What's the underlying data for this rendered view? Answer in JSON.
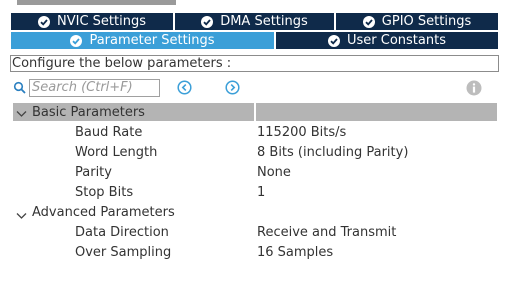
{
  "tabs": {
    "row1": [
      {
        "label": "NVIC Settings"
      },
      {
        "label": "DMA Settings"
      },
      {
        "label": "GPIO Settings"
      }
    ],
    "row2": [
      {
        "label": "Parameter Settings",
        "active": true
      },
      {
        "label": "User Constants"
      }
    ]
  },
  "description": "Configure the below parameters :",
  "search": {
    "placeholder": "Search (Ctrl+F)"
  },
  "groups": [
    {
      "label": "Basic Parameters",
      "expanded": true,
      "params": [
        {
          "name": "Baud Rate",
          "value": "115200 Bits/s"
        },
        {
          "name": "Word Length",
          "value": "8 Bits (including Parity)"
        },
        {
          "name": "Parity",
          "value": "None"
        },
        {
          "name": "Stop Bits",
          "value": "1"
        }
      ]
    },
    {
      "label": "Advanced Parameters",
      "expanded": true,
      "params": [
        {
          "name": "Data Direction",
          "value": "Receive and Transmit"
        },
        {
          "name": "Over Sampling",
          "value": "16 Samples"
        }
      ]
    }
  ],
  "colors": {
    "tab_dark": "#0f2a4a",
    "tab_active": "#3b9fd8",
    "group_header": "#b4b4b4",
    "nav_arrow": "#3b9fd8",
    "info_icon": "#bdbdbd"
  },
  "icons": {
    "tab": "check-circle-icon",
    "search": "search-icon",
    "prev": "arrow-left-circle-icon",
    "next": "arrow-right-circle-icon",
    "info": "info-icon",
    "expand": "chevron-down-icon"
  }
}
